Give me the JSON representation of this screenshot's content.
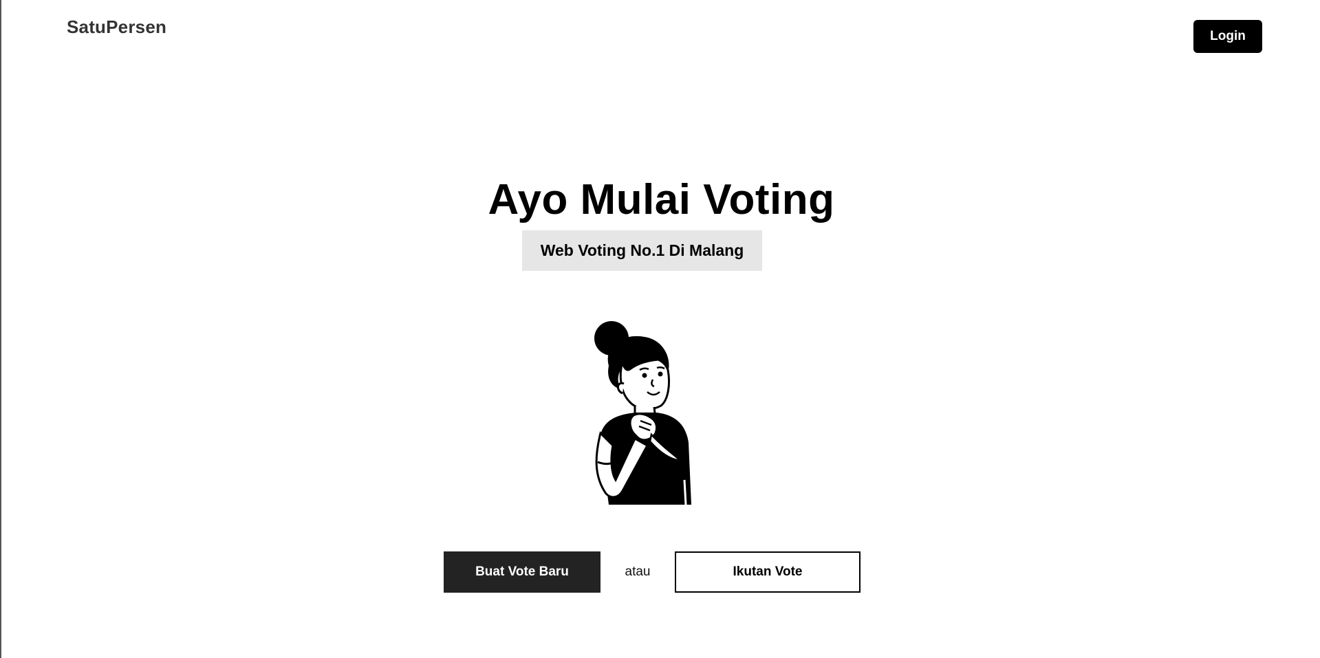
{
  "header": {
    "brand": "SatuPersen",
    "login_label": "Login"
  },
  "hero": {
    "title": "Ayo Mulai Voting",
    "tagline": "Web Voting No.1 Di Malang",
    "illustration": "person-thinking-illustration"
  },
  "actions": {
    "create_label": "Buat Vote Baru",
    "or_text": "atau",
    "join_label": "Ikutan Vote"
  },
  "colors": {
    "background": "#ffffff",
    "primary": "#000000",
    "primary_button": "#232323",
    "tagline_bg": "#e6e6e6",
    "brand_text": "#333333"
  }
}
